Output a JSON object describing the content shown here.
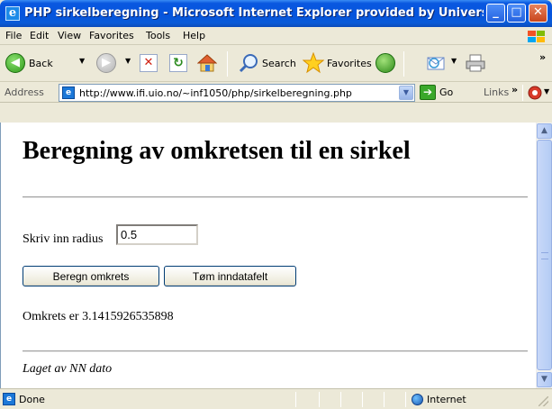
{
  "window": {
    "title": "PHP sirkelberegning - Microsoft Internet Explorer provided by Universite...",
    "min_glyph": "_",
    "max_glyph": "□",
    "close_glyph": "✕",
    "app_icon": "e"
  },
  "menu": {
    "items": [
      "File",
      "Edit",
      "View",
      "Favorites",
      "Tools",
      "Help"
    ]
  },
  "toolbar": {
    "back_label": "Back",
    "search_label": "Search",
    "favorites_label": "Favorites",
    "overflow": "»"
  },
  "address": {
    "label": "Address",
    "url": "http://www.ifi.uio.no/~inf1050/php/sirkelberegning.php",
    "go_label": "Go",
    "links_label": "Links",
    "links_overflow": "»"
  },
  "page": {
    "title": "Beregning av omkretsen til en sirkel",
    "radius_label": "Skriv inn radius",
    "radius_value": "0.5",
    "calc_button": "Beregn omkrets",
    "clear_button": "Tøm inndatafelt",
    "result_text": "Omkrets er 3.1415926535898",
    "footer": "Laget av NN dato"
  },
  "status": {
    "text": "Done",
    "zone": "Internet"
  },
  "colors": {
    "titlebar": "#0554dd",
    "chrome": "#ece9d8",
    "back_green": "#2e9a1a"
  },
  "icons": [
    "app-ie-icon",
    "windows-logo-icon",
    "back-arrow-icon",
    "forward-arrow-icon",
    "stop-icon",
    "refresh-icon",
    "home-icon",
    "search-icon",
    "favorites-star-icon",
    "media-icon",
    "mail-icon",
    "print-icon",
    "page-icon",
    "go-arrow-icon",
    "globe-icon"
  ]
}
